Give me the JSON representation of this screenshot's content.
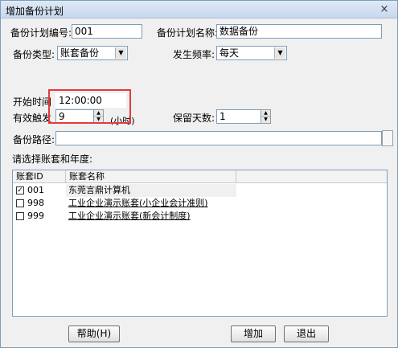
{
  "window": {
    "title": "增加备份计划",
    "close": "×"
  },
  "form": {
    "plan_no_label": "备份计划编号:",
    "plan_no_value": "001",
    "plan_name_label": "备份计划名称:",
    "plan_name_value": "数据备份",
    "backup_type_label": "备份类型:",
    "backup_type_value": "账套备份",
    "frequency_label": "发生频率:",
    "frequency_value": "每天",
    "start_time_label": "开始时间",
    "start_time_value": "12:00:00",
    "valid_trigger_label": "有效触发",
    "valid_trigger_value": "9",
    "valid_trigger_unit": "(小时)",
    "retain_days_label": "保留天数:",
    "retain_days_value": "1",
    "path_label": "备份路径:",
    "path_value": "",
    "select_label": "请选择账套和年度:"
  },
  "list": {
    "columns": [
      "账套ID",
      "账套名称"
    ],
    "rows": [
      {
        "id": "001",
        "name": "东莞言鼎计算机",
        "checked": true
      },
      {
        "id": "998",
        "name": "工业企业演示账套(小企业会计准则)",
        "checked": false
      },
      {
        "id": "999",
        "name": "工业企业演示账套(新会计制度)",
        "checked": false
      }
    ]
  },
  "buttons": {
    "help": "帮助(H)",
    "add": "增加",
    "exit": "退出"
  },
  "colors": {
    "highlight": "#e53a3a"
  },
  "icons": {
    "dropdown": "chevron-down-icon",
    "spin_up": "arrow-up-icon",
    "spin_down": "arrow-down-icon"
  }
}
